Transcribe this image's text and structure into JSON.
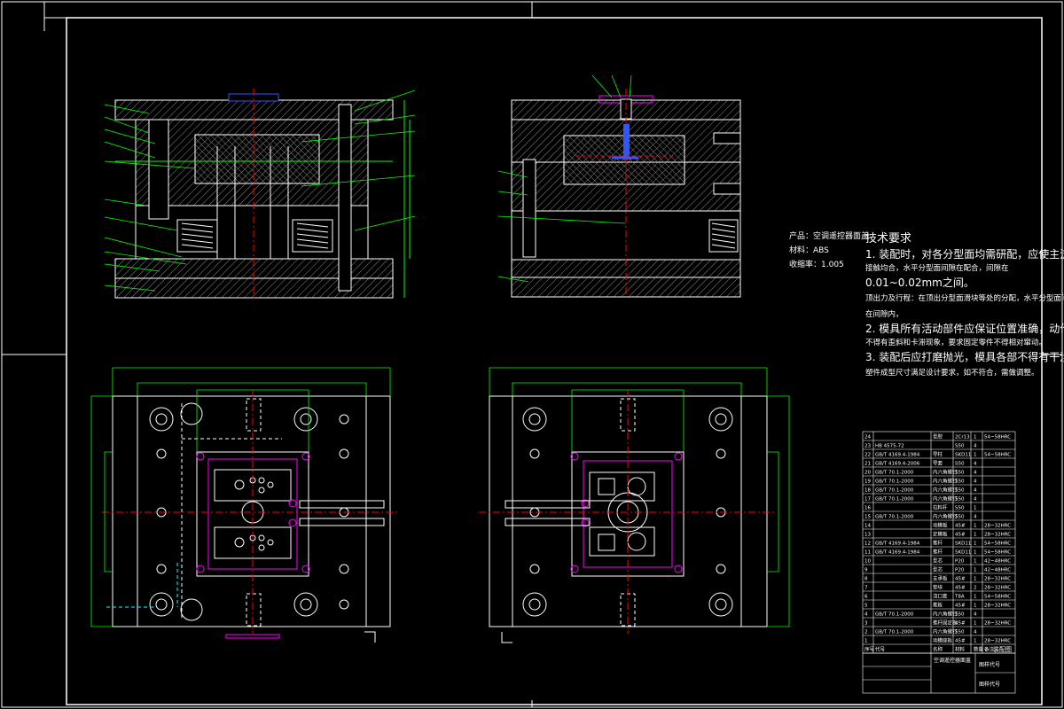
{
  "product_info": {
    "product": "产品：空调遥控器面盖",
    "material": "材料：ABS",
    "shrink": "收缩率：1.005"
  },
  "tech_requirements": {
    "title": "技术要求",
    "lines": [
      "1. 装配时，对各分型面均需研配，应使主流分型面",
      "接触均合，水平分型面间隙在配合，间隙在",
      "0.01~0.02mm之间。",
      "顶出力及行程：在顶出分型面滑块等处的分配，水平分型面间隙",
      "在间隙内，",
      "2. 模具所有活动部件应保证位置准确，动作可靠，",
      "不得有歪斜和卡滞现象，要求固定零件不得相对窜动。",
      "3. 装配后应打磨抛光，模具各部不得有干涉现象。",
      "塑件成型尺寸满足设计要求，如不符合，需做调整。"
    ]
  },
  "bom_rows": [
    {
      "no": "24",
      "std": "",
      "name": "型腔",
      "mat": "2Cr13",
      "qty": "1",
      "note": "54~58HRC"
    },
    {
      "no": "23",
      "std": "HB 4575-72",
      "name": "",
      "mat": "S50",
      "qty": "4",
      "note": ""
    },
    {
      "no": "22",
      "std": "GB/T 4169.4-1984",
      "name": "导柱",
      "mat": "SKD11",
      "qty": "1",
      "note": "54~58HRC"
    },
    {
      "no": "21",
      "std": "GB/T 4169.4-2006",
      "name": "导套",
      "mat": "S50",
      "qty": "4",
      "note": ""
    },
    {
      "no": "20",
      "std": "GB/T 70.1-2000",
      "name": "内六角螺钉",
      "mat": "S50",
      "qty": "4",
      "note": ""
    },
    {
      "no": "19",
      "std": "GB/T 70.1-2000",
      "name": "内六角螺钉",
      "mat": "S50",
      "qty": "4",
      "note": ""
    },
    {
      "no": "18",
      "std": "GB/T 70.1-2000",
      "name": "内六角螺钉",
      "mat": "S50",
      "qty": "4",
      "note": ""
    },
    {
      "no": "17",
      "std": "GB/T 70.1-2000",
      "name": "内六角螺钉",
      "mat": "S50",
      "qty": "4",
      "note": ""
    },
    {
      "no": "16",
      "std": "",
      "name": "拉料杆",
      "mat": "S50",
      "qty": "1",
      "note": ""
    },
    {
      "no": "15",
      "std": "GB/T 70.1-2000",
      "name": "内六角螺钉",
      "mat": "S50",
      "qty": "4",
      "note": ""
    },
    {
      "no": "14",
      "std": "",
      "name": "动模板",
      "mat": "45#",
      "qty": "1",
      "note": "28~32HRC"
    },
    {
      "no": "13",
      "std": "",
      "name": "定模板",
      "mat": "45#",
      "qty": "1",
      "note": "28~32HRC"
    },
    {
      "no": "12",
      "std": "GB/T 4169.4-1984",
      "name": "推杆",
      "mat": "SKD11",
      "qty": "1",
      "note": "54~58HRC"
    },
    {
      "no": "11",
      "std": "GB/T 4169.4-1984",
      "name": "推杆",
      "mat": "SKD11",
      "qty": "1",
      "note": "54~58HRC"
    },
    {
      "no": "10",
      "std": "",
      "name": "型芯",
      "mat": "P20",
      "qty": "1",
      "note": "42~48HRC"
    },
    {
      "no": "9",
      "std": "",
      "name": "型芯",
      "mat": "P20",
      "qty": "1",
      "note": "42~48HRC"
    },
    {
      "no": "8",
      "std": "",
      "name": "支承板",
      "mat": "45#",
      "qty": "1",
      "note": "28~32HRC"
    },
    {
      "no": "7",
      "std": "",
      "name": "垫块",
      "mat": "45#",
      "qty": "2",
      "note": "28~32HRC"
    },
    {
      "no": "6",
      "std": "",
      "name": "浇口套",
      "mat": "T8A",
      "qty": "1",
      "note": "54~58HRC"
    },
    {
      "no": "5",
      "std": "",
      "name": "推板",
      "mat": "45#",
      "qty": "1",
      "note": "28~32HRC"
    },
    {
      "no": "4",
      "std": "GB/T 70.1-2000",
      "name": "内六角螺钉",
      "mat": "S50",
      "qty": "4",
      "note": ""
    },
    {
      "no": "3",
      "std": "",
      "name": "推杆固定板",
      "mat": "45#",
      "qty": "1",
      "note": "28~32HRC"
    },
    {
      "no": "2",
      "std": "GB/T 70.1-2000",
      "name": "内六角螺钉",
      "mat": "S50",
      "qty": "4",
      "note": ""
    },
    {
      "no": "1",
      "std": "",
      "name": "动模座板",
      "mat": "45#",
      "qty": "1",
      "note": "28~32HRC"
    }
  ],
  "bom_header": {
    "no": "序号",
    "std": "代号",
    "name": "名称",
    "mat": "材料",
    "qty": "数量",
    "note": "备注"
  },
  "title_block": {
    "drawing_name": "装配图",
    "company": "空调遥控器面盖",
    "drawing_no": "图样代号",
    "school": "图样代号"
  },
  "colors": {
    "bg": "#000000",
    "line": "#ffffff",
    "center": "#ff0000",
    "dim": "#00ff00",
    "hidden": "#00ffff",
    "magenta": "#ff00ff",
    "blue": "#3355ff"
  }
}
